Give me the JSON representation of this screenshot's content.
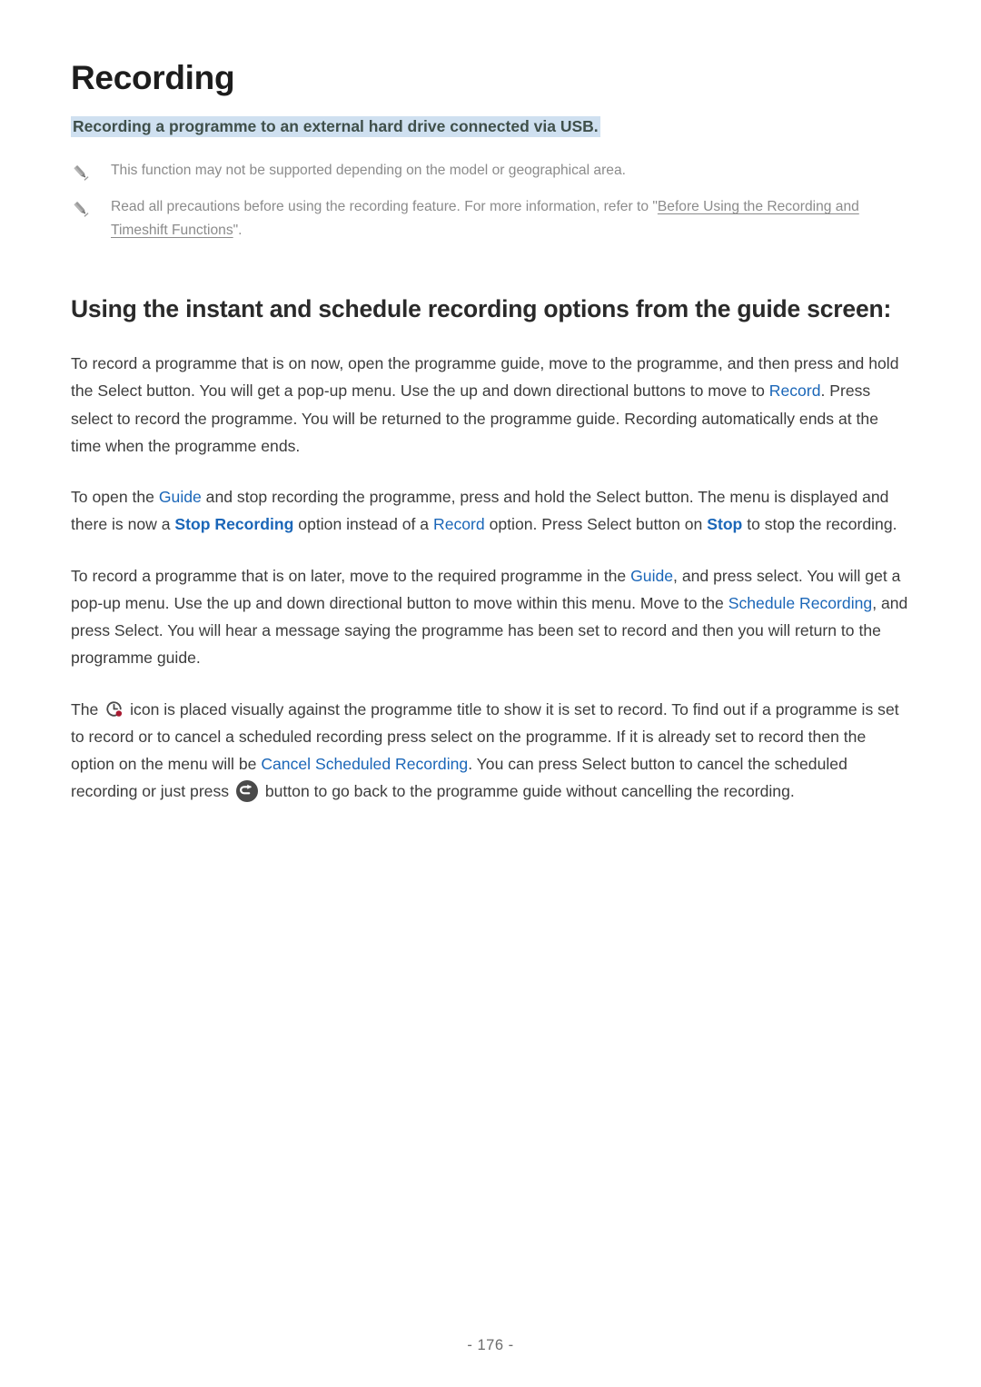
{
  "document": {
    "title": "Recording",
    "subtitle": "Recording a programme to an external hard drive connected via USB.",
    "page_number": "- 176 -"
  },
  "notes": [
    {
      "icon": "pencil-icon",
      "text_before": "This function may not be supported depending on the model or geographical area.",
      "xref": "",
      "text_after": ""
    },
    {
      "icon": "pencil-icon",
      "text_before": "Read all precautions before using the recording feature. For more information, refer to \"",
      "xref": "Before Using the Recording and Timeshift Functions",
      "text_after": "\"."
    }
  ],
  "section": {
    "heading": "Using the instant and schedule recording options from the guide screen:"
  },
  "paragraphs": {
    "p1": {
      "s1": "To record a programme that is on now, open the programme guide, move to the programme, and then press and hold the Select button. You will get a pop-up menu. Use the up and down directional buttons to move to ",
      "link1": "Record",
      "s2": ". Press select to record the programme. You will be returned to the programme guide. Recording automatically ends at the time when the programme ends."
    },
    "p2": {
      "s1": "To open the ",
      "link1": "Guide",
      "s2": " and stop recording the programme, press and hold the Select button. The menu is displayed and there is now a ",
      "link2": "Stop Recording",
      "s3": " option instead of a ",
      "link3": "Record",
      "s4": " option. Press Select button on ",
      "link4": "Stop",
      "s5": " to stop the recording."
    },
    "p3": {
      "s1": "To record a programme that is on later, move to the required programme in the ",
      "link1": "Guide",
      "s2": ", and press select. You will get a pop-up menu. Use the up and down directional button to move within this menu. Move to the ",
      "link2": "Schedule Recording",
      "s3": ", and press Select. You will hear a message saying the programme has been set to record and then you will return to the programme guide."
    },
    "p4": {
      "s1": "The ",
      "icon1": "record-clock-icon",
      "s2": " icon is placed visually against the programme title to show it is set to record. To find out if a programme is set to record or to cancel a scheduled recording press select on the programme. If it is already set to record then the option on the menu will be ",
      "link1": "Cancel Scheduled Recording",
      "s3": ". You can press Select button to cancel the scheduled recording or just press ",
      "icon2": "return-icon",
      "s4": " button to go back to the programme guide without cancelling the recording."
    }
  },
  "colors": {
    "link_blue": "#1a66b8",
    "highlight_blue": "#cfe0f0",
    "note_gray": "#8b8b8b",
    "body_text": "#3c3c3c",
    "record_dot_red": "#a81b32"
  }
}
